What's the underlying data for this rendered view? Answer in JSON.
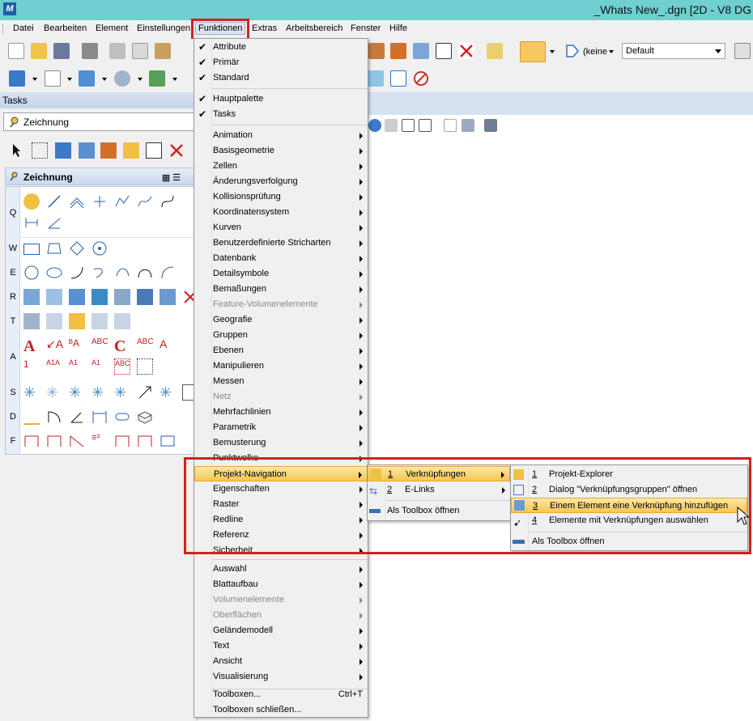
{
  "window": {
    "title": "_Whats New_.dgn [2D - V8 DG"
  },
  "menubar": [
    "Datei",
    "Bearbeiten",
    "Element",
    "Einstellungen",
    "Funktionen",
    "Extras",
    "Arbeitsbereich",
    "Fenster",
    "Hilfe"
  ],
  "toolbar": {
    "level_combo": "(keine",
    "style_combo": "Default"
  },
  "tasks": {
    "header": "Tasks",
    "selected": "Zeichnung",
    "group_title": "Zeichnung",
    "letters": [
      "Q",
      "W",
      "E",
      "R",
      "T",
      "A",
      "S",
      "D",
      "F"
    ]
  },
  "funktionen_menu": {
    "checked_items": [
      "Attribute",
      "Primär",
      "Standard"
    ],
    "palette_items": [
      "Hauptpalette",
      "Tasks"
    ],
    "items": [
      {
        "label": "Animation",
        "disabled": false
      },
      {
        "label": "Basisgeometrie",
        "disabled": false
      },
      {
        "label": "Zellen",
        "disabled": false
      },
      {
        "label": "Änderungsverfolgung",
        "disabled": false
      },
      {
        "label": "Kollisionsprüfung",
        "disabled": false
      },
      {
        "label": "Koordinatensystem",
        "disabled": false
      },
      {
        "label": "Kurven",
        "disabled": false
      },
      {
        "label": "Benutzerdefinierte Stricharten",
        "disabled": false
      },
      {
        "label": "Datenbank",
        "disabled": false
      },
      {
        "label": "Detailsymbole",
        "disabled": false
      },
      {
        "label": "Bemaßungen",
        "disabled": false
      },
      {
        "label": "Feature-Volumenelemente",
        "disabled": true
      },
      {
        "label": "Geografie",
        "disabled": false
      },
      {
        "label": "Gruppen",
        "disabled": false
      },
      {
        "label": "Ebenen",
        "disabled": false
      },
      {
        "label": "Manipulieren",
        "disabled": false
      },
      {
        "label": "Messen",
        "disabled": false
      },
      {
        "label": "Netz",
        "disabled": true
      },
      {
        "label": "Mehrfachlinien",
        "disabled": false
      },
      {
        "label": "Parametrik",
        "disabled": false
      },
      {
        "label": "Bemusterung",
        "disabled": false
      },
      {
        "label": "Punktwolke",
        "disabled": false
      },
      {
        "label": "Projekt-Navigation",
        "disabled": false,
        "highlighted": true
      },
      {
        "label": "Eigenschaften",
        "disabled": false
      },
      {
        "label": "Raster",
        "disabled": false
      },
      {
        "label": "Redline",
        "disabled": false
      },
      {
        "label": "Referenz",
        "disabled": false
      },
      {
        "label": "Sicherheit",
        "disabled": false
      },
      {
        "label": "Auswahl",
        "disabled": false
      },
      {
        "label": "Blattaufbau",
        "disabled": false
      },
      {
        "label": "Volumenelemente",
        "disabled": true
      },
      {
        "label": "Oberflächen",
        "disabled": true
      },
      {
        "label": "Geländemodell",
        "disabled": false
      },
      {
        "label": "Text",
        "disabled": false
      },
      {
        "label": "Ansicht",
        "disabled": false
      },
      {
        "label": "Visualisierung",
        "disabled": false
      }
    ],
    "toolboxen": "Toolboxen...",
    "toolboxen_shortcut": "Ctrl+T",
    "toolboxen_close": "Toolboxen schließen..."
  },
  "projekt_nav_menu": {
    "items": [
      {
        "num": "1",
        "label": "Verknüpfungen"
      },
      {
        "num": "2",
        "label": "E-Links"
      }
    ],
    "toolbox": "Als Toolbox öffnen"
  },
  "verknuepfungen_menu": {
    "items": [
      {
        "num": "1",
        "label": "Projekt-Explorer"
      },
      {
        "num": "2",
        "label": "Dialog \"Verknüpfungsgruppen\" öffnen"
      },
      {
        "num": "3",
        "label": "Einem Element eine Verknüpfung hinzufügen"
      },
      {
        "num": "4",
        "label": "Elemente mit Verknüpfungen auswählen"
      }
    ],
    "toolbox": "Als Toolbox öffnen"
  },
  "colors": {
    "highlight": "#f6c652",
    "annotation_red": "#d42020",
    "titlebar": "#6fcfd1"
  }
}
